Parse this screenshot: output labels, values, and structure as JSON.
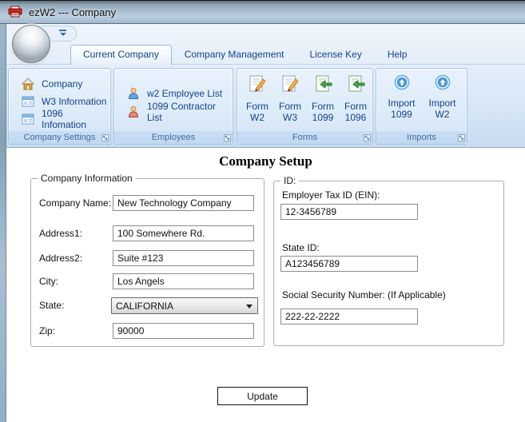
{
  "window": {
    "title": "ezW2 --- Company"
  },
  "chrome": {
    "tabs": [
      {
        "label": "Current Company",
        "active": true
      },
      {
        "label": "Company Management",
        "active": false
      },
      {
        "label": "License Key",
        "active": false
      },
      {
        "label": "Help",
        "active": false
      }
    ],
    "ribbon_groups": [
      {
        "label": "Company Settings",
        "items": [
          {
            "icon": "building-icon",
            "label": "Company"
          },
          {
            "icon": "form-window-icon",
            "label": "W3 Information"
          },
          {
            "icon": "form-window-icon",
            "label": "1096 Infomation"
          }
        ]
      },
      {
        "label": "Employees",
        "items": [
          {
            "icon": "person-blue-icon",
            "label": "w2 Employee List"
          },
          {
            "icon": "person-red-icon",
            "label": "1099 Contractor List"
          }
        ]
      },
      {
        "label": "Forms",
        "items": [
          {
            "icon": "form-edit-icon",
            "line1": "Form",
            "line2": "W2"
          },
          {
            "icon": "form-edit-icon",
            "line1": "Form",
            "line2": "W3"
          },
          {
            "icon": "form-import-icon",
            "line1": "Form",
            "line2": "1099"
          },
          {
            "icon": "form-import-icon",
            "line1": "Form",
            "line2": "1096"
          }
        ]
      },
      {
        "label": "Imports",
        "items": [
          {
            "icon": "import-up-icon",
            "line1": "Import",
            "line2": "1099"
          },
          {
            "icon": "import-up-icon",
            "line1": "Import",
            "line2": "W2"
          }
        ]
      }
    ]
  },
  "main": {
    "title": "Company Setup",
    "company_info": {
      "legend": "Company Information",
      "fields": [
        {
          "label": "Company Name:",
          "value": "New Technology Company"
        },
        {
          "label": "Address1:",
          "value": "100 Somewhere Rd."
        },
        {
          "label": "Address2:",
          "value": "Suite #123"
        },
        {
          "label": "City:",
          "value": "Los Angels"
        },
        {
          "label": "State:",
          "value": "CALIFORNIA"
        },
        {
          "label": "Zip:",
          "value": "90000"
        }
      ]
    },
    "id_info": {
      "legend": "ID:",
      "fields": [
        {
          "label": "Employer Tax ID (EIN):",
          "value": "12-3456789"
        },
        {
          "label": "State ID:",
          "value": "A123456789"
        },
        {
          "label": "Social Security Number: (If Applicable)",
          "value": "222-22-2222"
        }
      ]
    },
    "update_label": "Update"
  },
  "colors": {
    "tab_text": "#15428b",
    "group_label_text": "#3e6ca4",
    "ribbon_bg": "#d6e6f6",
    "app_icon_red": "#cf1f1f"
  }
}
